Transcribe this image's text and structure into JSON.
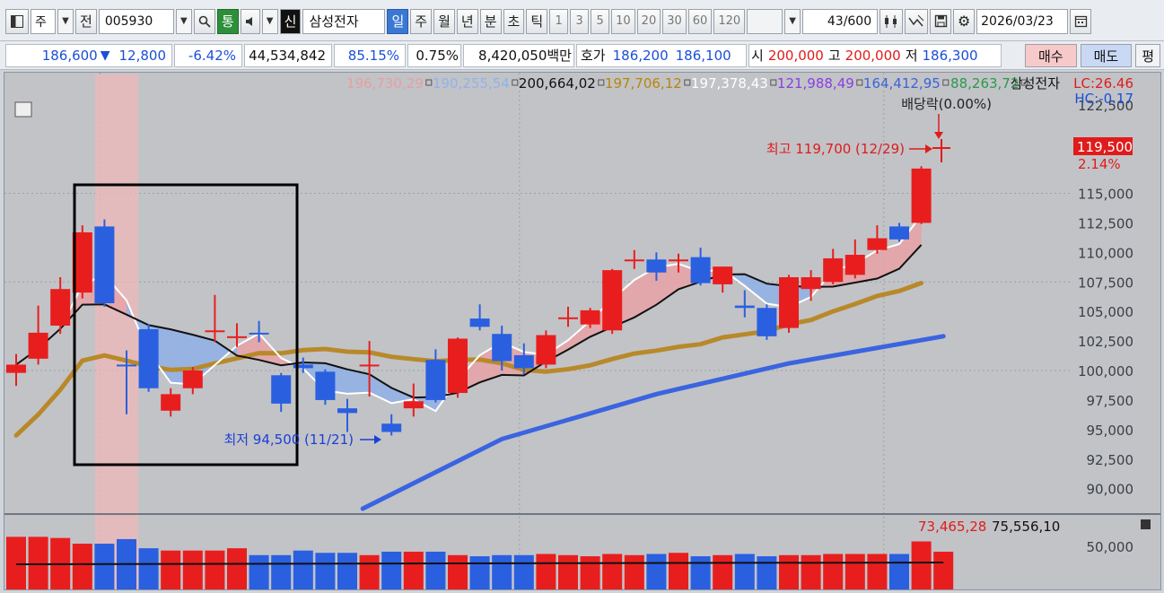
{
  "toolbar": {
    "market": "주",
    "prev": "전",
    "code": "005930",
    "tong": "통",
    "shin": "신",
    "name": "삼성전자",
    "periods": [
      "일",
      "주",
      "월",
      "년",
      "분",
      "초",
      "틱"
    ],
    "active_period": "일",
    "intervals": [
      "1",
      "3",
      "5",
      "10",
      "20",
      "30",
      "60",
      "120"
    ],
    "count": "43",
    "count_total": "/600",
    "date": "2026/03/23"
  },
  "quote": {
    "price": "186,600",
    "arrow": "▼",
    "change": "12,800",
    "change_pct": "-6.42%",
    "volume": "44,534,842",
    "vol_ratio": "85.15%",
    "turnover": "0.75%",
    "amount": "8,420,050백만",
    "hoga_label": "호가",
    "ask": "186,200",
    "bid": "186,100",
    "open_label": "시",
    "open": "200,000",
    "high_label": "고",
    "high": "200,000",
    "low_label": "저",
    "low": "186,300",
    "buy": "매수",
    "sell": "매도",
    "avg": "평"
  },
  "legend": [
    {
      "text": "196,730,29",
      "color": "#e6a0a0"
    },
    {
      "text": "190,255,54",
      "color": "#8fb3ea"
    },
    {
      "text": "200,664,02",
      "color": "#111111"
    },
    {
      "text": "197,706,12",
      "color": "#b8860b"
    },
    {
      "text": "197,378,43",
      "color": "#ffffff"
    },
    {
      "text": "121,988,49",
      "color": "#8a3fe0"
    },
    {
      "text": "164,412,95",
      "color": "#3a64d8"
    },
    {
      "text": "88,263,72",
      "color": "#2a9a4a"
    },
    {
      "text": "삼성전자",
      "color": "#111111"
    }
  ],
  "lc": "LC:26.46",
  "hc": "HC:-0.17",
  "dividend": "배당락(0.00%)",
  "high_note": "최고 119,700 (12/29)",
  "low_note": "최저 94,500 (11/21)",
  "price_tag": "119,500",
  "price_tag_pct": "2.14%",
  "vol_legend": {
    "a": "73,465,28",
    "b": "75,556,10"
  },
  "chart_data": {
    "type": "candlestick",
    "yaxis_ticks": [
      "122,500",
      "115,000",
      "112,500",
      "110,000",
      "107,500",
      "105,000",
      "102,500",
      "100,000",
      "97,500",
      "95,000",
      "92,500",
      "90,000"
    ],
    "volume_tick": "50,000",
    "candles": [
      {
        "o": 99800,
        "h": 101400,
        "l": 98700,
        "c": 100500
      },
      {
        "o": 101000,
        "h": 105500,
        "l": 100500,
        "c": 103200
      },
      {
        "o": 103800,
        "h": 107900,
        "l": 103100,
        "c": 106900
      },
      {
        "o": 106600,
        "h": 112300,
        "l": 106100,
        "c": 111700
      },
      {
        "o": 112200,
        "h": 112800,
        "l": 105400,
        "c": 105700
      },
      {
        "o": 100500,
        "h": 101700,
        "l": 96300,
        "c": 100400
      },
      {
        "o": 103500,
        "h": 103900,
        "l": 98200,
        "c": 98500
      },
      {
        "o": 96600,
        "h": 98500,
        "l": 96100,
        "c": 98000
      },
      {
        "o": 98500,
        "h": 100300,
        "l": 98000,
        "c": 100000
      },
      {
        "o": 103400,
        "h": 106400,
        "l": 102400,
        "c": 103400
      },
      {
        "o": 102800,
        "h": 104000,
        "l": 102000,
        "c": 102900
      },
      {
        "o": 103200,
        "h": 104200,
        "l": 102400,
        "c": 103100
      },
      {
        "o": 99600,
        "h": 99800,
        "l": 96500,
        "c": 97200
      },
      {
        "o": 100500,
        "h": 101100,
        "l": 99800,
        "c": 100200
      },
      {
        "o": 99900,
        "h": 100100,
        "l": 97100,
        "c": 97500
      },
      {
        "o": 96800,
        "h": 97600,
        "l": 94800,
        "c": 96400
      },
      {
        "o": 100500,
        "h": 102500,
        "l": 97800,
        "c": 100500
      },
      {
        "o": 95500,
        "h": 96300,
        "l": 94500,
        "c": 94800
      },
      {
        "o": 96800,
        "h": 98900,
        "l": 96100,
        "c": 97400
      },
      {
        "o": 100900,
        "h": 101800,
        "l": 97300,
        "c": 97500
      },
      {
        "o": 98100,
        "h": 102800,
        "l": 97700,
        "c": 102700
      },
      {
        "o": 104400,
        "h": 105600,
        "l": 103400,
        "c": 103700
      },
      {
        "o": 103100,
        "h": 103800,
        "l": 100000,
        "c": 100800
      },
      {
        "o": 101300,
        "h": 102300,
        "l": 99700,
        "c": 100200
      },
      {
        "o": 100500,
        "h": 103400,
        "l": 100200,
        "c": 103000
      },
      {
        "o": 104500,
        "h": 105400,
        "l": 103700,
        "c": 104500
      },
      {
        "o": 103900,
        "h": 105300,
        "l": 103600,
        "c": 105100
      },
      {
        "o": 103400,
        "h": 108600,
        "l": 103100,
        "c": 108500
      },
      {
        "o": 109400,
        "h": 110200,
        "l": 108600,
        "c": 109400
      },
      {
        "o": 109400,
        "h": 110000,
        "l": 107600,
        "c": 108300
      },
      {
        "o": 109400,
        "h": 109900,
        "l": 108300,
        "c": 109400
      },
      {
        "o": 109600,
        "h": 110400,
        "l": 107200,
        "c": 107400
      },
      {
        "o": 107300,
        "h": 108800,
        "l": 106600,
        "c": 108800
      },
      {
        "o": 105500,
        "h": 106800,
        "l": 104500,
        "c": 105300
      },
      {
        "o": 105300,
        "h": 105600,
        "l": 102600,
        "c": 102900
      },
      {
        "o": 103600,
        "h": 108100,
        "l": 103200,
        "c": 107900
      },
      {
        "o": 106900,
        "h": 108500,
        "l": 105900,
        "c": 107900
      },
      {
        "o": 107500,
        "h": 110300,
        "l": 107300,
        "c": 109500
      },
      {
        "o": 108100,
        "h": 111100,
        "l": 107800,
        "c": 109800
      },
      {
        "o": 110200,
        "h": 112300,
        "l": 109900,
        "c": 111200
      },
      {
        "o": 112200,
        "h": 112500,
        "l": 110900,
        "c": 111100
      },
      {
        "o": 112500,
        "h": 117300,
        "l": 112400,
        "c": 117100
      }
    ],
    "volumes": [
      46,
      46,
      45,
      40,
      40,
      44,
      36,
      34,
      34,
      34,
      36,
      30,
      30,
      34,
      32,
      32,
      30,
      33,
      33,
      33,
      30,
      29,
      30,
      30,
      31,
      30,
      29,
      31,
      30,
      31,
      32,
      29,
      30,
      31,
      29,
      30,
      30,
      31,
      31,
      31,
      31,
      42,
      33
    ]
  }
}
